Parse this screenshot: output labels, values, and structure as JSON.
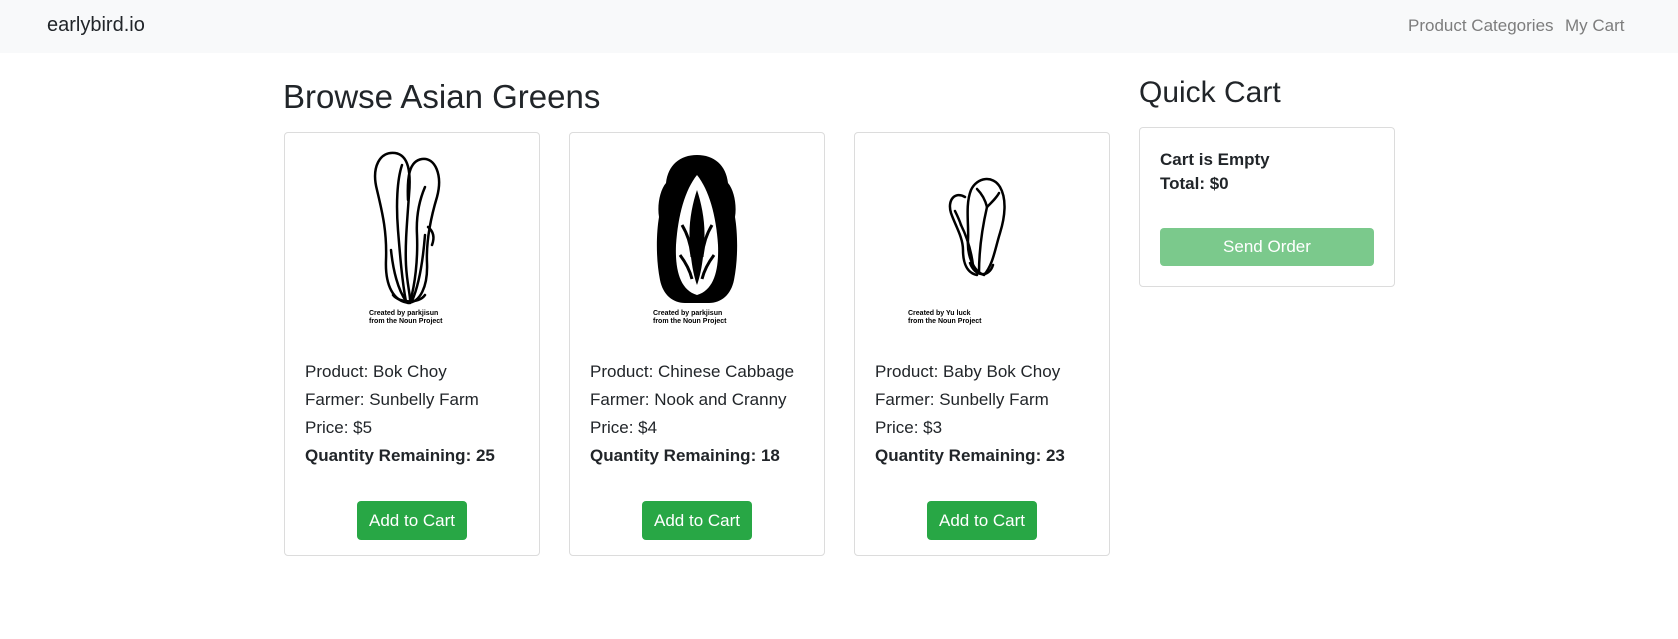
{
  "navbar": {
    "brand": "earlybird.io",
    "links": [
      "Product Categories",
      "My Cart"
    ]
  },
  "page_title": "Browse Asian Greens",
  "products": [
    {
      "icon": "bok-choy-icon",
      "credit_line1": "Created by parkjisun",
      "credit_line2": "from the Noun Project",
      "product": "Product: Bok Choy",
      "farmer": "Farmer: Sunbelly Farm",
      "price": "Price: $5",
      "quantity": "Quantity Remaining: 25",
      "button": "Add to Cart"
    },
    {
      "icon": "chinese-cabbage-icon",
      "credit_line1": "Created by parkjisun",
      "credit_line2": "from the Noun Project",
      "product": "Product: Chinese Cabbage",
      "farmer": "Farmer: Nook and Cranny",
      "price": "Price: $4",
      "quantity": "Quantity Remaining: 18",
      "button": "Add to Cart"
    },
    {
      "icon": "baby-bok-choy-icon",
      "credit_line1": "Created by Yu luck",
      "credit_line2": "from the Noun Project",
      "product": "Product: Baby Bok Choy",
      "farmer": "Farmer: Sunbelly Farm",
      "price": "Price: $3",
      "quantity": "Quantity Remaining: 23",
      "button": "Add to Cart"
    }
  ],
  "quick_cart": {
    "title": "Quick Cart",
    "status": "Cart is Empty",
    "total": "Total: $0",
    "button": "Send Order"
  },
  "colors": {
    "navbar_bg": "#f8f9fa",
    "primary_button": "#28a745",
    "disabled_button": "#7bc98c",
    "nav_link": "#7d7d7d"
  }
}
